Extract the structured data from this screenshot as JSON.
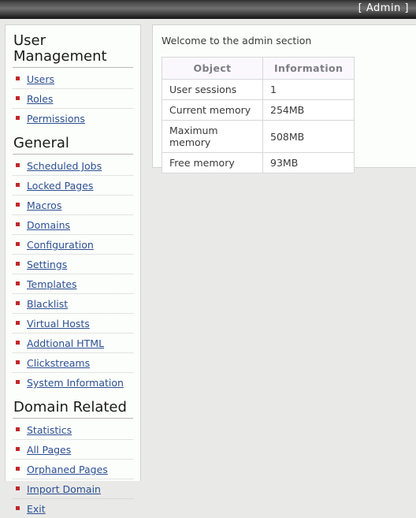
{
  "topbar": {
    "title": "[ Admin ]"
  },
  "sidebar": {
    "sections": [
      {
        "title": "User Management",
        "items": [
          {
            "label": "Users"
          },
          {
            "label": "Roles"
          },
          {
            "label": "Permissions"
          }
        ]
      },
      {
        "title": "General",
        "items": [
          {
            "label": "Scheduled Jobs"
          },
          {
            "label": "Locked Pages"
          },
          {
            "label": "Macros"
          },
          {
            "label": "Domains"
          },
          {
            "label": "Configuration"
          },
          {
            "label": "Settings"
          },
          {
            "label": "Templates"
          },
          {
            "label": "Blacklist"
          },
          {
            "label": "Virtual Hosts"
          },
          {
            "label": "Addtional HTML"
          },
          {
            "label": "Clickstreams"
          },
          {
            "label": "System Information"
          }
        ]
      },
      {
        "title": "Domain Related",
        "items": [
          {
            "label": "Statistics"
          },
          {
            "label": "All Pages"
          },
          {
            "label": "Orphaned Pages"
          },
          {
            "label": "Import Domain"
          },
          {
            "label": "Exit"
          }
        ]
      }
    ]
  },
  "main": {
    "welcome": "Welcome to the admin section",
    "table": {
      "headers": [
        "Object",
        "Information"
      ],
      "rows": [
        {
          "object": "User sessions",
          "information": "1"
        },
        {
          "object": "Current memory",
          "information": "254MB"
        },
        {
          "object": "Maximum memory",
          "information": "508MB"
        },
        {
          "object": "Free memory",
          "information": "93MB"
        }
      ]
    }
  },
  "colors": {
    "link": "#2c4f93",
    "bullet": "#c0282a",
    "panel_bg": "#fcfefb",
    "page_bg": "#e9eae8",
    "table_header_bg": "#faf8fc"
  }
}
